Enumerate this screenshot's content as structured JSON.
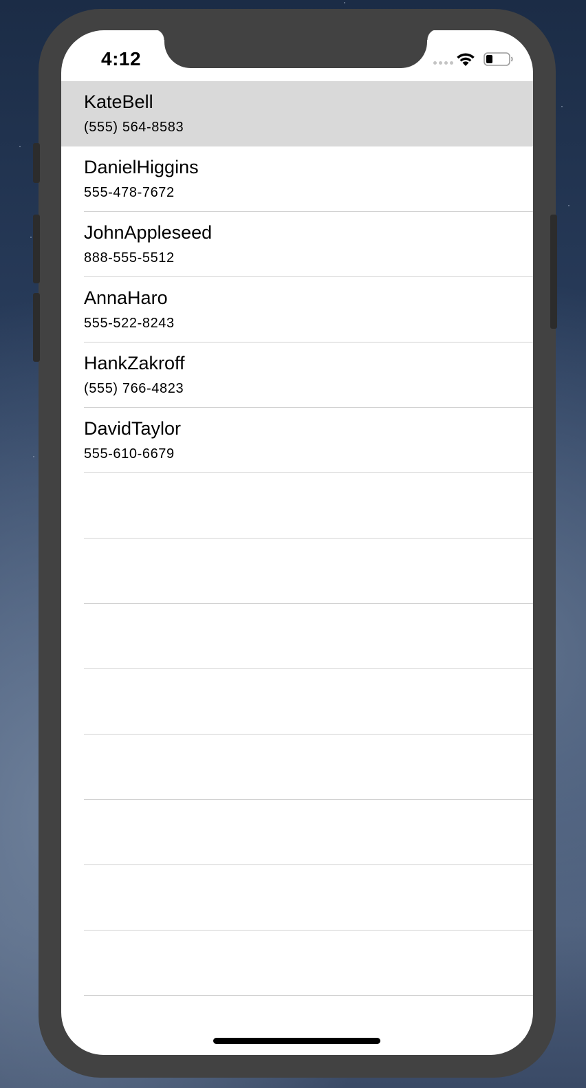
{
  "status_bar": {
    "time": "4:12",
    "wifi_icon": "wifi-icon",
    "battery_icon": "battery-icon"
  },
  "contacts": [
    {
      "name": "KateBell",
      "phone": "(555) 564-8583",
      "selected": true
    },
    {
      "name": "DanielHiggins",
      "phone": "555-478-7672",
      "selected": false
    },
    {
      "name": "JohnAppleseed",
      "phone": "888-555-5512",
      "selected": false
    },
    {
      "name": "AnnaHaro",
      "phone": "555-522-8243",
      "selected": false
    },
    {
      "name": "HankZakroff",
      "phone": "(555) 766-4823",
      "selected": false
    },
    {
      "name": "DavidTaylor",
      "phone": "555-610-6679",
      "selected": false
    }
  ],
  "colors": {
    "selected_row": "#d9d9d9",
    "separator": "#d2d2d2",
    "device_frame": "#424242"
  }
}
